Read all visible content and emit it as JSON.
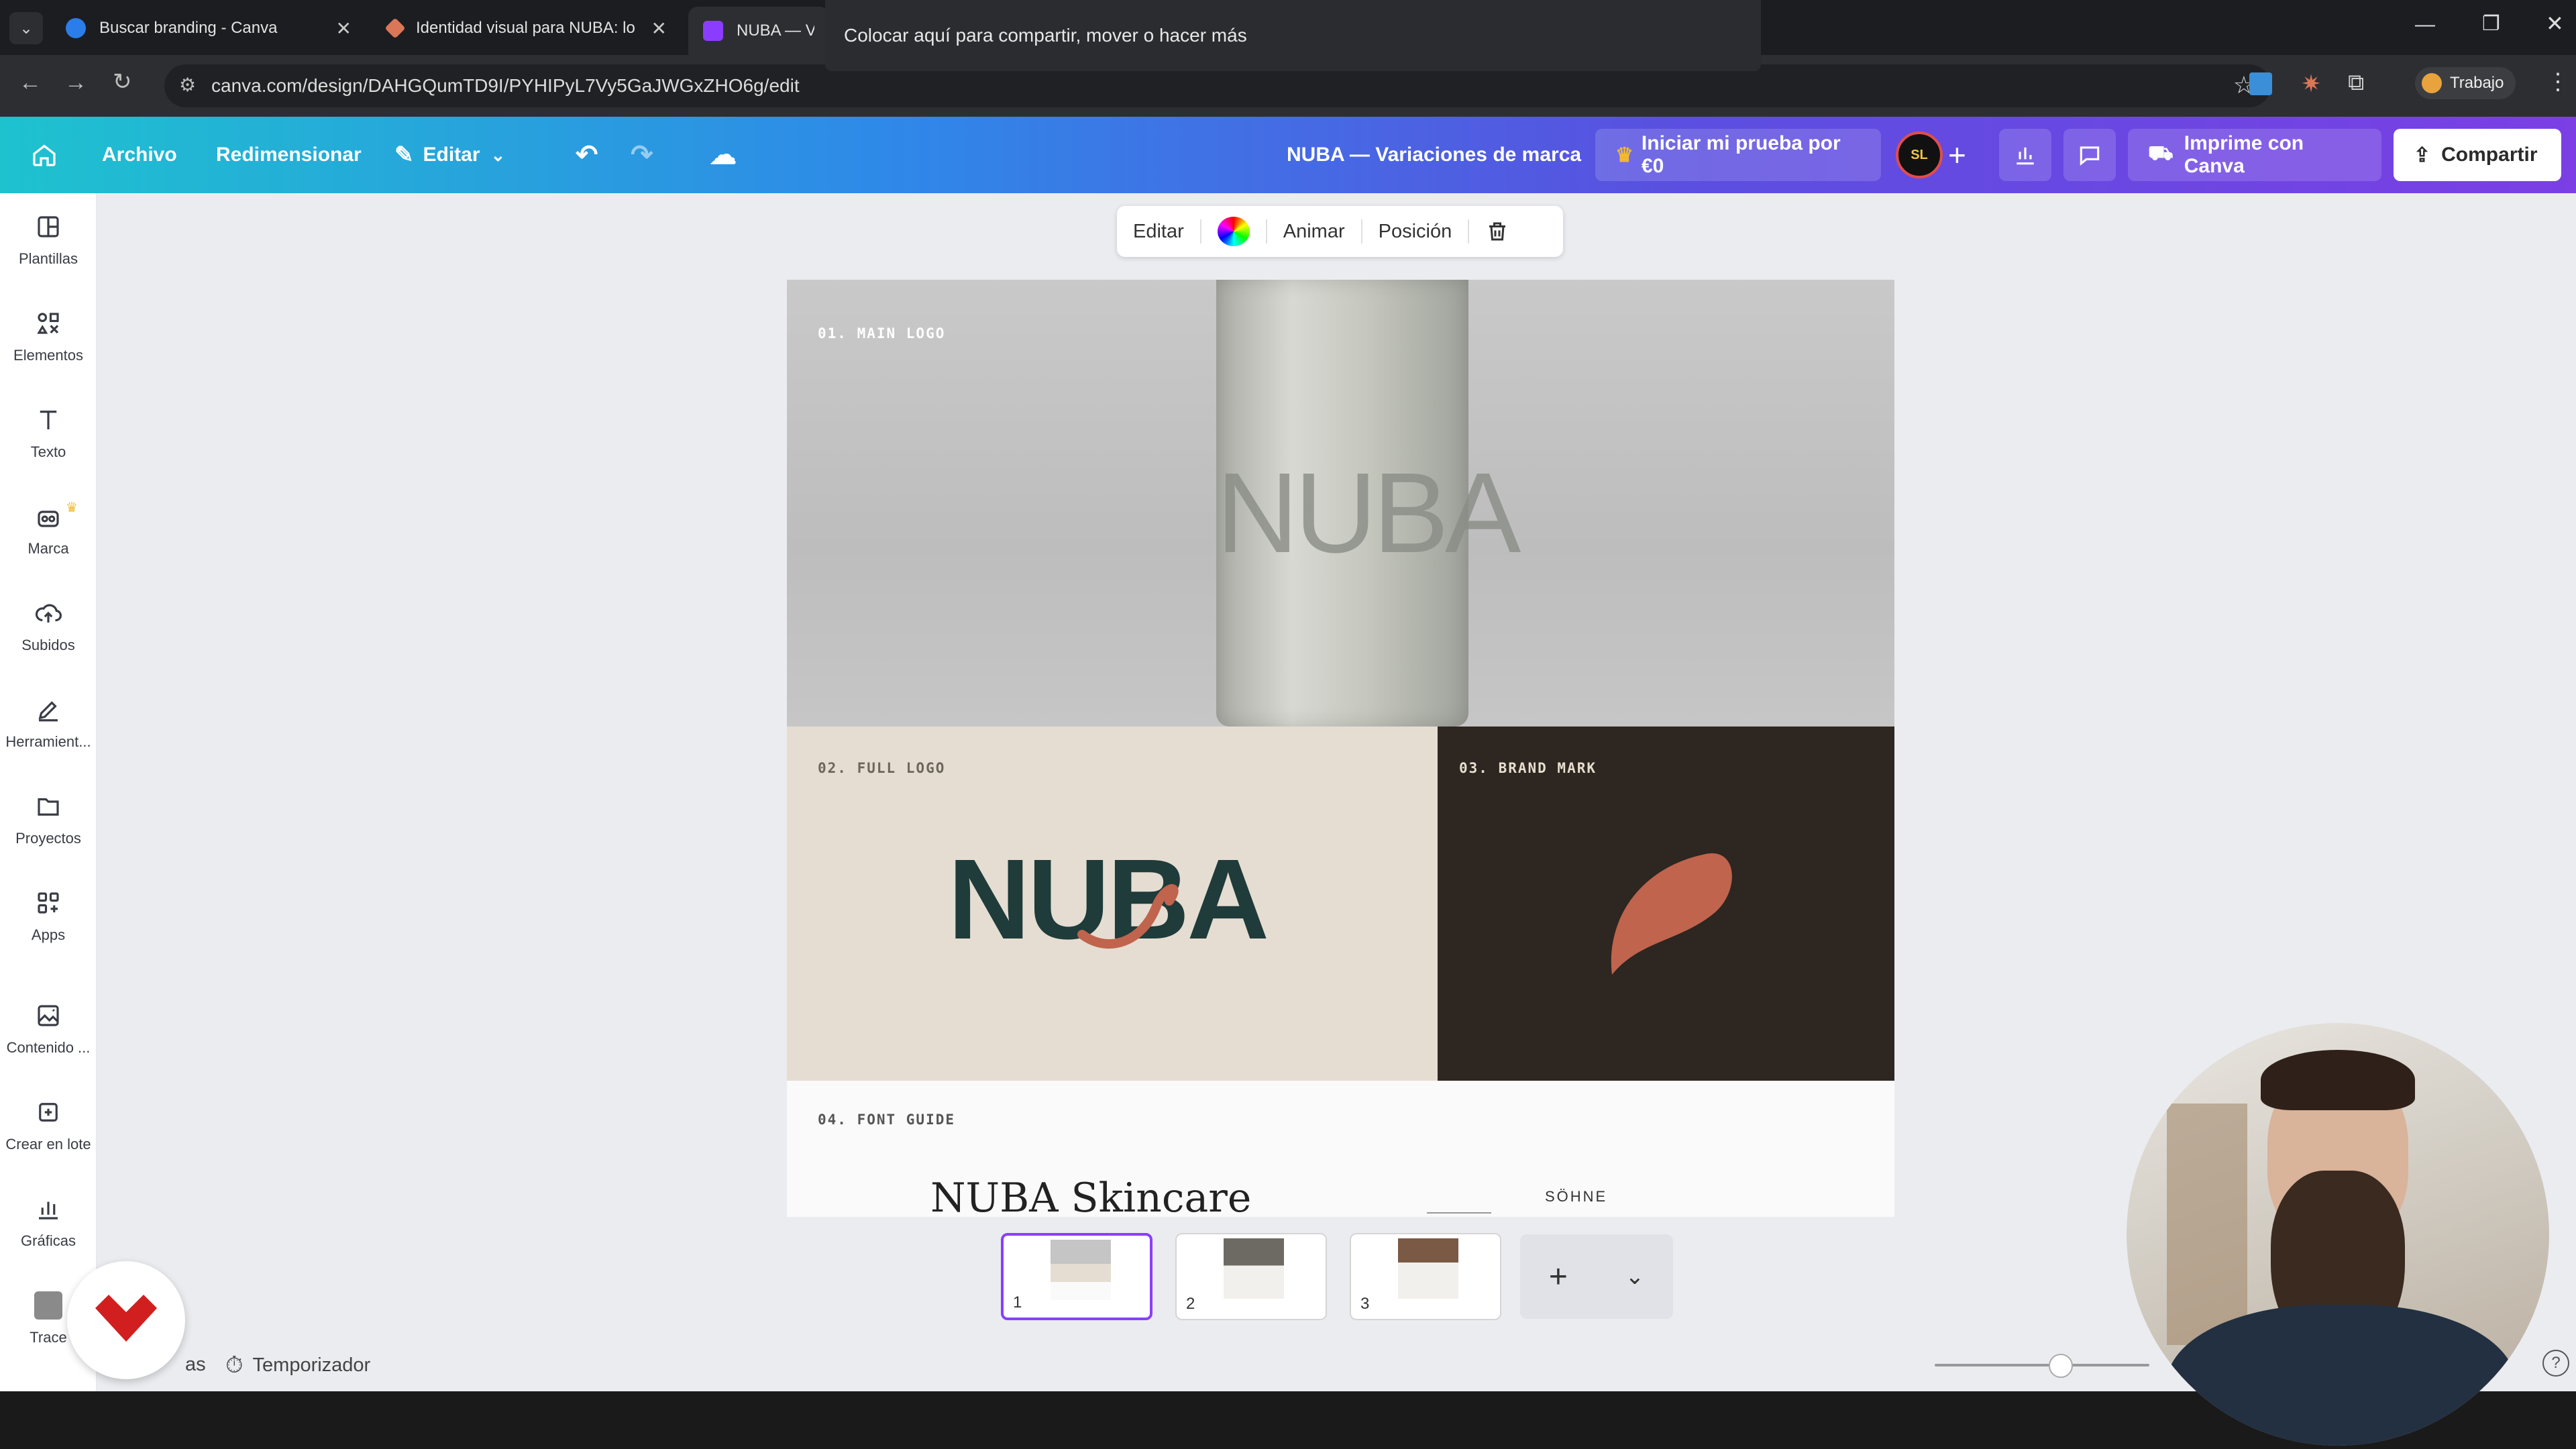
{
  "browser": {
    "tabs": [
      {
        "label": "Buscar branding - Canva",
        "favicon_color": "#2b7de9"
      },
      {
        "label": "Identidad visual para NUBA: lo",
        "favicon_color": "#d97757"
      },
      {
        "label": "NUBA — Va",
        "favicon_color": "#8b3dff"
      }
    ],
    "tooltip": "Colocar aquí para compartir, mover o hacer más",
    "url": "canva.com/design/DAHGQumTD9I/PYHIPyL7Vy5GaJWGxZHO6g/edit",
    "profile_label": "Trabajo"
  },
  "header": {
    "archivo": "Archivo",
    "redimensionar": "Redimensionar",
    "editar": "Editar",
    "doc_title": "NUBA — Variaciones de marca",
    "trial": "Iniciar mi prueba por €0",
    "print": "Imprime con Canva",
    "share": "Compartir",
    "avatar_text": "SL"
  },
  "sidebar": {
    "items": [
      {
        "label": "Plantillas",
        "icon": "templates-icon"
      },
      {
        "label": "Elementos",
        "icon": "elements-icon"
      },
      {
        "label": "Texto",
        "icon": "text-icon"
      },
      {
        "label": "Marca",
        "icon": "brand-icon"
      },
      {
        "label": "Subidos",
        "icon": "upload-icon"
      },
      {
        "label": "Herramient...",
        "icon": "tools-icon"
      },
      {
        "label": "Proyectos",
        "icon": "folder-icon"
      },
      {
        "label": "Apps",
        "icon": "apps-icon"
      },
      {
        "label": "Contenido ...",
        "icon": "magic-media-icon"
      },
      {
        "label": "Crear en lote",
        "icon": "bulk-create-icon"
      },
      {
        "label": "Gráficas",
        "icon": "charts-icon"
      },
      {
        "label": "Trace",
        "icon": "avatar-icon"
      }
    ]
  },
  "context_toolbar": {
    "edit": "Editar",
    "animate": "Animar",
    "position": "Posición"
  },
  "design": {
    "section1_label": "01. MAIN LOGO",
    "section1_bottle_text": "NUBA",
    "section2_label": "02. FULL LOGO",
    "section2_logo_text": "NUBA",
    "section3_label": "03. BRAND MARK",
    "section4_label": "04. FONT GUIDE",
    "font_heading": "NUBA Skincare",
    "font_name": "SÖHNE",
    "colors": {
      "brand_dark": "#1f3b3a",
      "brand_accent": "#c0644d",
      "beige": "#e5ddd2",
      "dark_panel": "#2d2621"
    }
  },
  "pages": {
    "thumbnails": [
      {
        "number": "1",
        "active": true
      },
      {
        "number": "2",
        "active": false
      },
      {
        "number": "3",
        "active": false
      }
    ]
  },
  "status": {
    "notes_fragment": "as",
    "timer": "Temporizador"
  }
}
